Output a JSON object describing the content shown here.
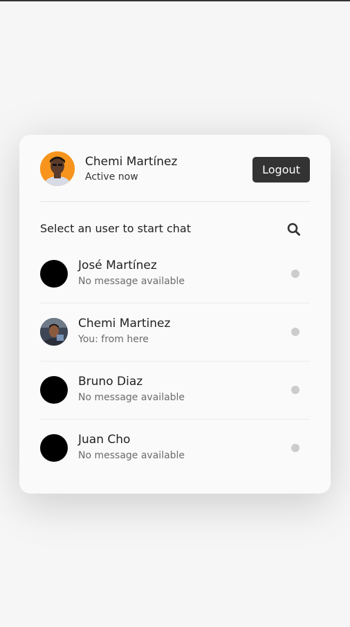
{
  "current_user": {
    "name": "Chemi Martínez",
    "status": "Active now",
    "avatar": "user-photo",
    "avatar_bg": "#f7941d"
  },
  "header": {
    "logout_label": "Logout"
  },
  "search": {
    "prompt": "Select an user to start chat",
    "icon": "search-icon"
  },
  "users": [
    {
      "name": "José Martínez",
      "message": "No message available",
      "avatar": "blank-avatar",
      "status": "offline"
    },
    {
      "name": "Chemi Martinez",
      "message": "You: from here",
      "avatar": "user-photo",
      "status": "offline"
    },
    {
      "name": "Bruno Diaz",
      "message": "No message available",
      "avatar": "blank-avatar",
      "status": "offline"
    },
    {
      "name": "Juan Cho",
      "message": "No message available",
      "avatar": "blank-avatar",
      "status": "offline"
    }
  ],
  "colors": {
    "accent": "#333333",
    "status_dot": "#cccccc",
    "background": "#f6f6f6"
  }
}
